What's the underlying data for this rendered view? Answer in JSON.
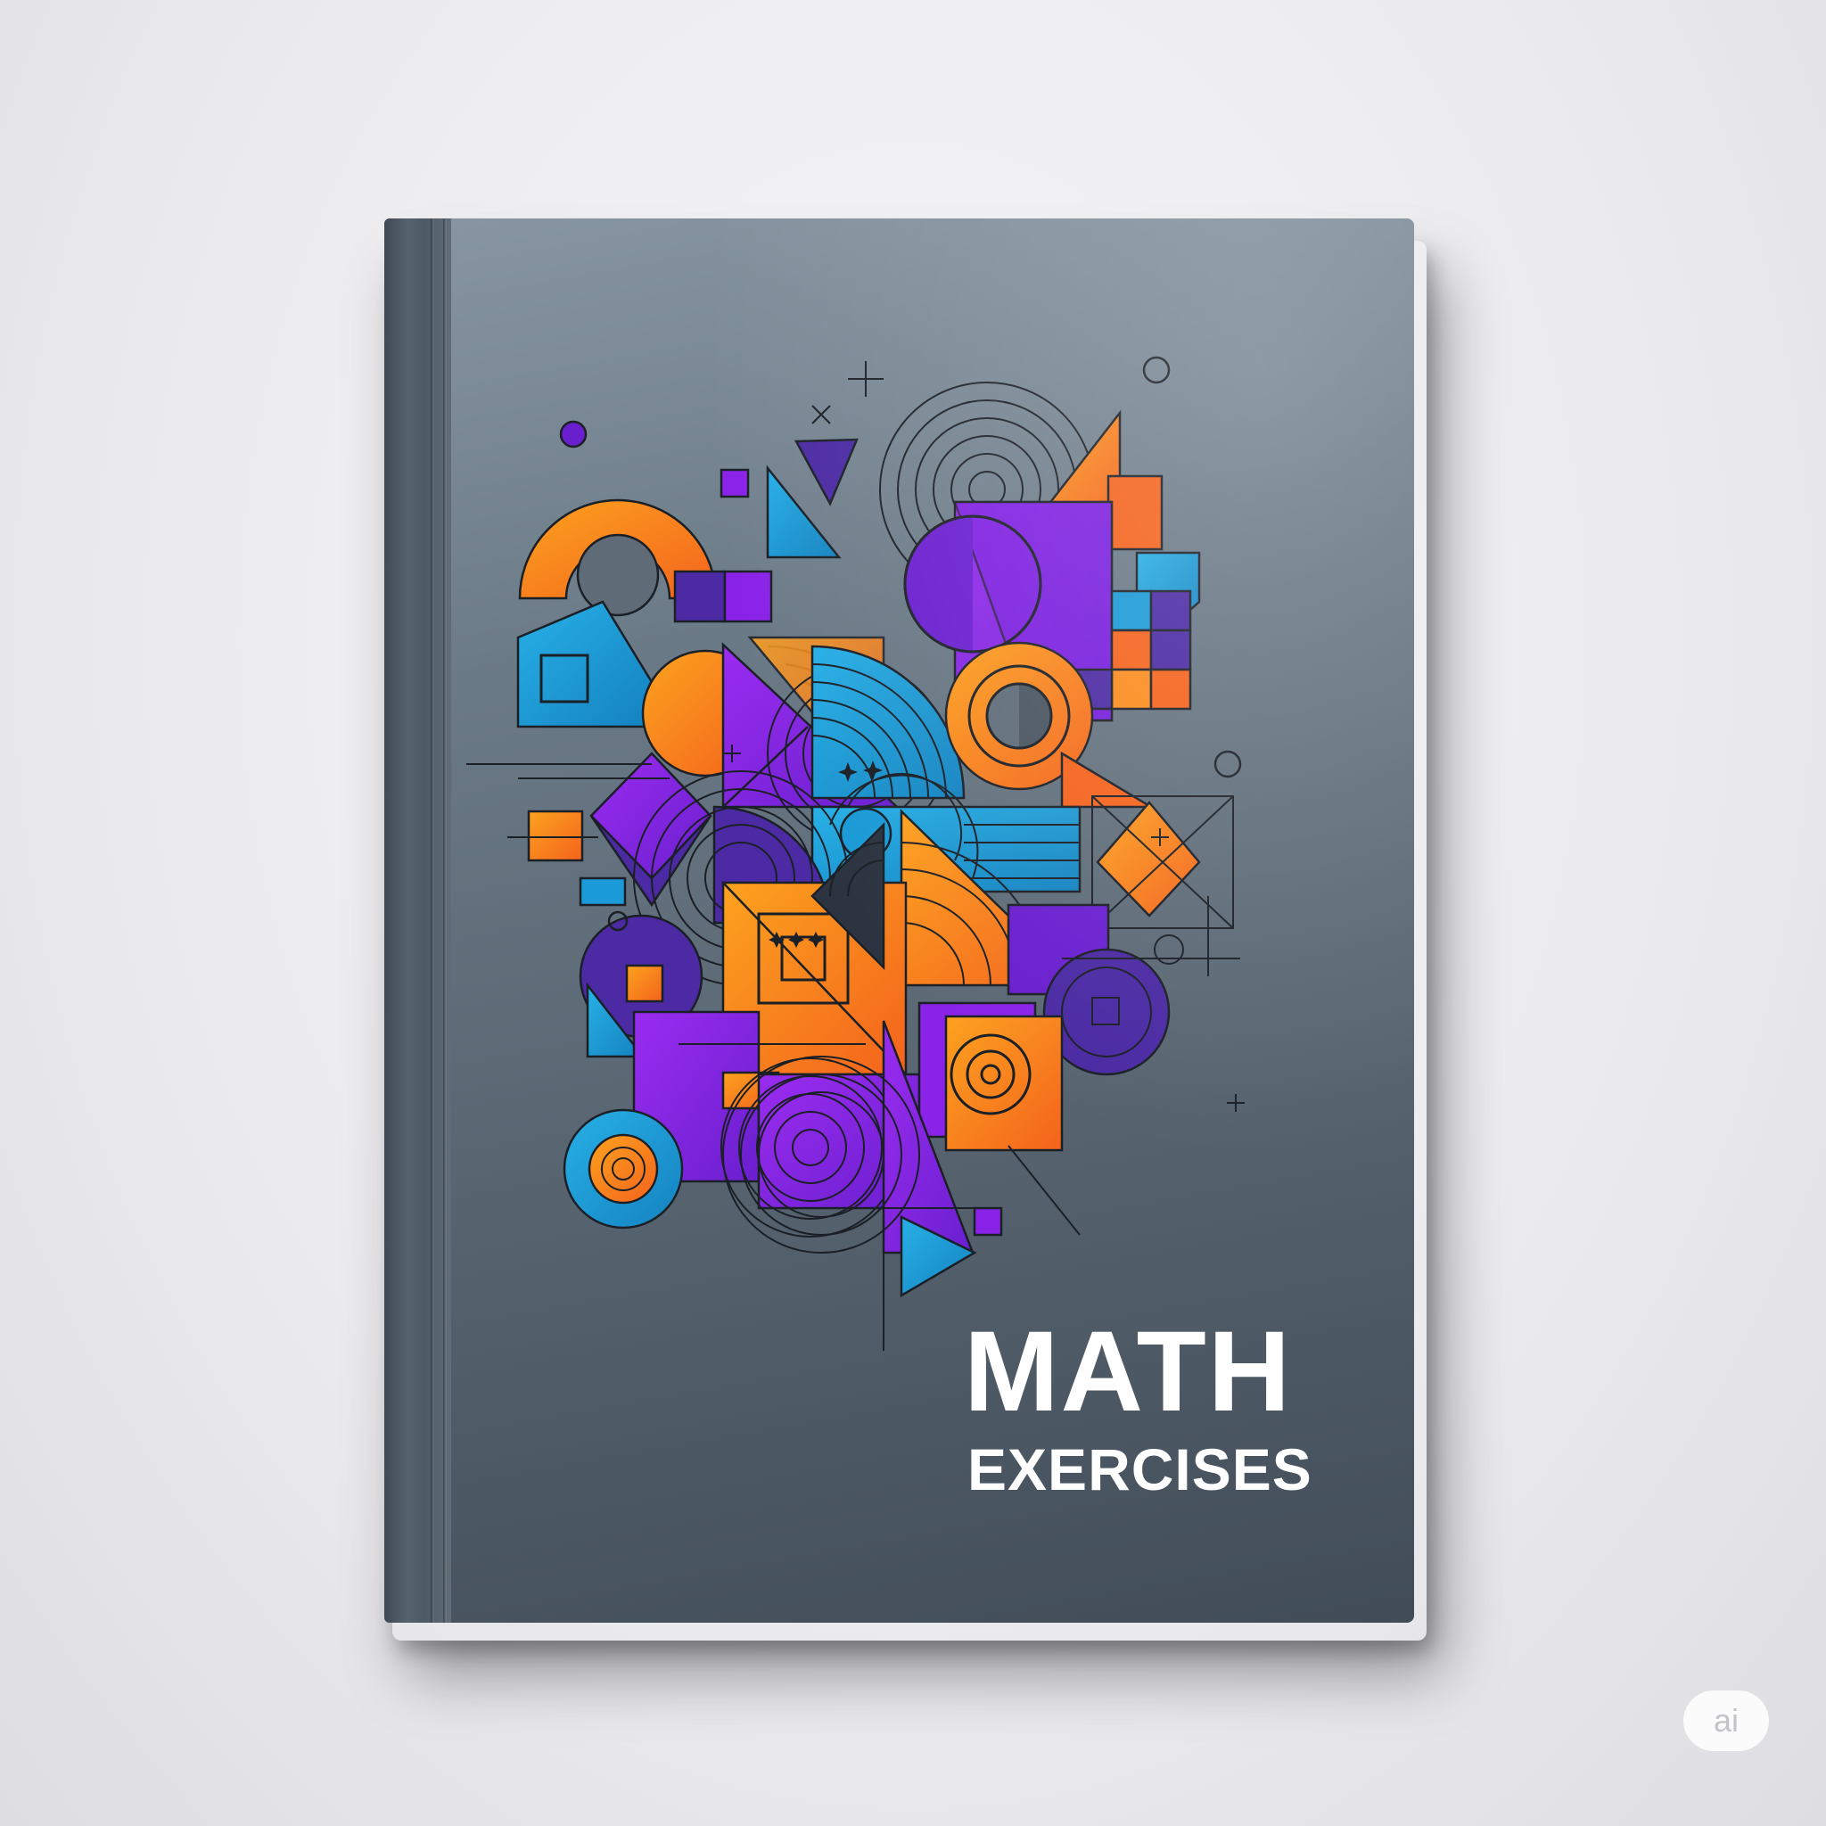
{
  "cover": {
    "title": "MATH",
    "subtitle": "EXERCISES"
  },
  "badge": {
    "label": "ai"
  },
  "colors": {
    "cover": "#5c6975",
    "orange": "#fb8c1e",
    "deep_orange": "#f4631c",
    "purple": "#8a22e8",
    "indigo": "#4b2aa3",
    "blue": "#1a9ad6",
    "line": "#1b1f26",
    "title_text": "#ffffff"
  },
  "icons": [
    "geometric-shapes-illustration"
  ]
}
